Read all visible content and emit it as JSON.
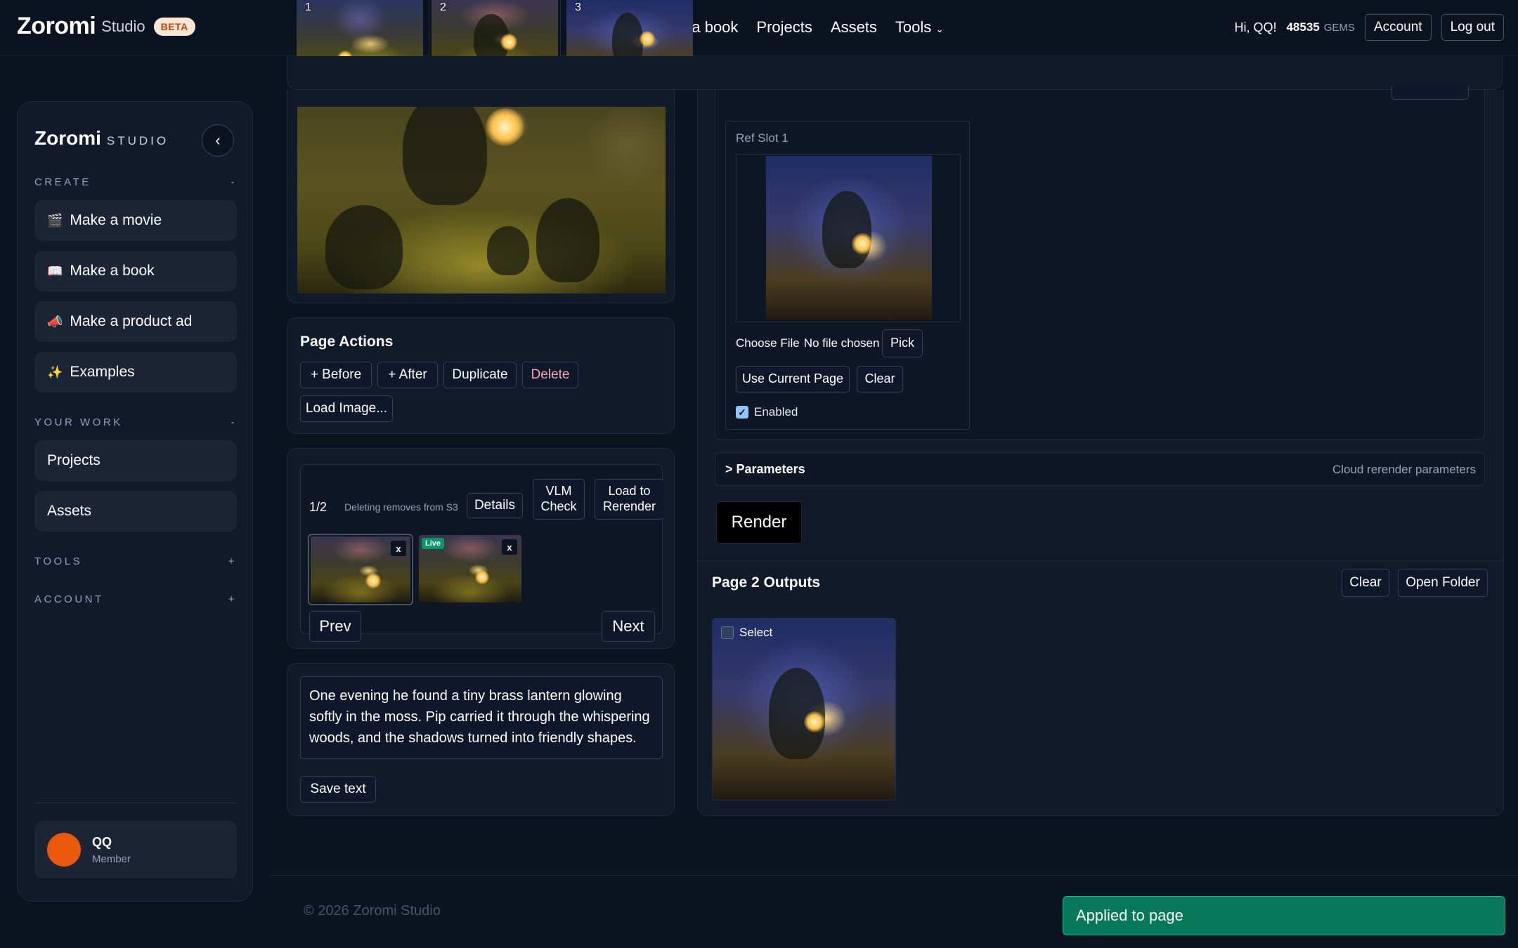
{
  "header": {
    "brand": "Zoromi",
    "brand_sub": "Studio",
    "beta": "BETA",
    "nav": [
      "e a book",
      "Projects",
      "Assets",
      "Tools"
    ],
    "greeting": "Hi, QQ!",
    "gems_value": "48535",
    "gems_label": "GEMS",
    "account": "Account",
    "logout": "Log out",
    "page_thumbs": [
      "1",
      "2",
      "3"
    ]
  },
  "sidebar": {
    "brand": "Zoromi",
    "brand_sub": "STUDIO",
    "create_label": "CREATE",
    "create_toggle": "-",
    "create_items": [
      {
        "icon": "🎬",
        "label": "Make a movie"
      },
      {
        "icon": "📖",
        "label": "Make a book"
      },
      {
        "icon": "📣",
        "label": "Make a product ad"
      },
      {
        "icon": "✨",
        "label": "Examples"
      }
    ],
    "work_label": "YOUR WORK",
    "work_toggle": "-",
    "work_items": [
      "Projects",
      "Assets"
    ],
    "tools_label": "TOOLS",
    "tools_toggle": "+",
    "account_label": "ACCOUNT",
    "account_toggle": "+",
    "user_name": "QQ",
    "user_role": "Member"
  },
  "page_actions": {
    "title": "Page Actions",
    "before": "+ Before",
    "after": "+ After",
    "duplicate": "Duplicate",
    "delete": "Delete",
    "load_image": "Load Image..."
  },
  "versions": {
    "counter": "1/2",
    "note": "Deleting removes from S3",
    "details": "Details",
    "vlm_check": "VLM Check",
    "load_to_rerender": "Load to Rerender",
    "live_badge": "Live",
    "remove": "x",
    "prev": "Prev",
    "next": "Next"
  },
  "page_text": {
    "content": "One evening he found a tiny brass lantern glowing softly in the moss. Pip carried it through the whispering woods, and the shadows turned into friendly shapes.",
    "save": "Save text"
  },
  "ref_slot": {
    "label": "Ref Slot 1",
    "choose_file": "Choose File",
    "no_file": "No file chosen",
    "pick": "Pick",
    "use_current": "Use Current Page",
    "clear": "Clear",
    "enabled_label": "Enabled",
    "enabled": true
  },
  "parameters": {
    "label": "> Parameters",
    "hint": "Cloud rerender parameters"
  },
  "render_button": "Render",
  "outputs": {
    "title": "Page 2 Outputs",
    "clear": "Clear",
    "open_folder": "Open Folder",
    "select_label": "Select"
  },
  "footer": "© 2026 Zoromi Studio",
  "toast": "Applied to page",
  "colors": {
    "background": "#0b1220",
    "panel": "#111a2b",
    "toast": "#047857",
    "delete_text": "#f9a8b4",
    "avatar": "#ea580c",
    "beta_bg": "#fde7d2"
  }
}
